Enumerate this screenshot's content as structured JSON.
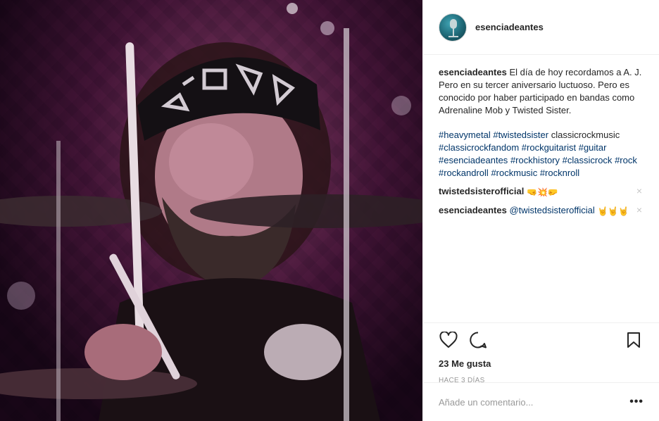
{
  "header": {
    "username": "esenciadeantes",
    "avatar_icon": "microphone-avatar-icon"
  },
  "caption": {
    "username": "esenciadeantes",
    "text": "El día de hoy recordamos a A. J. Pero en su tercer aniversario luctuoso. Pero es conocido por haber participado en bandas como Adrenaline Mob y Twisted Sister."
  },
  "tags": [
    {
      "text": "#heavymetal",
      "kind": "hashtag"
    },
    {
      "text": "#twistedsister",
      "kind": "hashtag"
    },
    {
      "text": "classicrockmusic",
      "kind": "plain"
    },
    {
      "text": "#classicrockfandom",
      "kind": "hashtag"
    },
    {
      "text": "#rockguitarist",
      "kind": "hashtag"
    },
    {
      "text": "#guitar",
      "kind": "hashtag"
    },
    {
      "text": "#esenciadeantes",
      "kind": "hashtag"
    },
    {
      "text": "#rockhistory",
      "kind": "hashtag"
    },
    {
      "text": "#classicrock",
      "kind": "hashtag"
    },
    {
      "text": "#rock",
      "kind": "hashtag"
    },
    {
      "text": "#rockandroll",
      "kind": "hashtag"
    },
    {
      "text": "#rockmusic",
      "kind": "hashtag"
    },
    {
      "text": "#rocknroll",
      "kind": "hashtag"
    }
  ],
  "comments": [
    {
      "username": "twistedsisterofficial",
      "mention": "",
      "emojis": "🤜💥🤛"
    },
    {
      "username": "esenciadeantes",
      "mention": "@twistedsisterofficial",
      "emojis": "🤘🤘🤘"
    }
  ],
  "delete_icon": "×",
  "actions": {
    "like_icon": "heart-icon",
    "comment_icon": "comment-bubble-icon",
    "save_icon": "bookmark-icon",
    "likes_text": "23 Me gusta",
    "timestamp": "HACE 3 DÍAS"
  },
  "add_comment": {
    "placeholder": "Añade un comentario...",
    "more_label": "•••"
  },
  "colors": {
    "link": "#003569",
    "muted": "#999999",
    "border": "#efefef",
    "text": "#262626"
  }
}
